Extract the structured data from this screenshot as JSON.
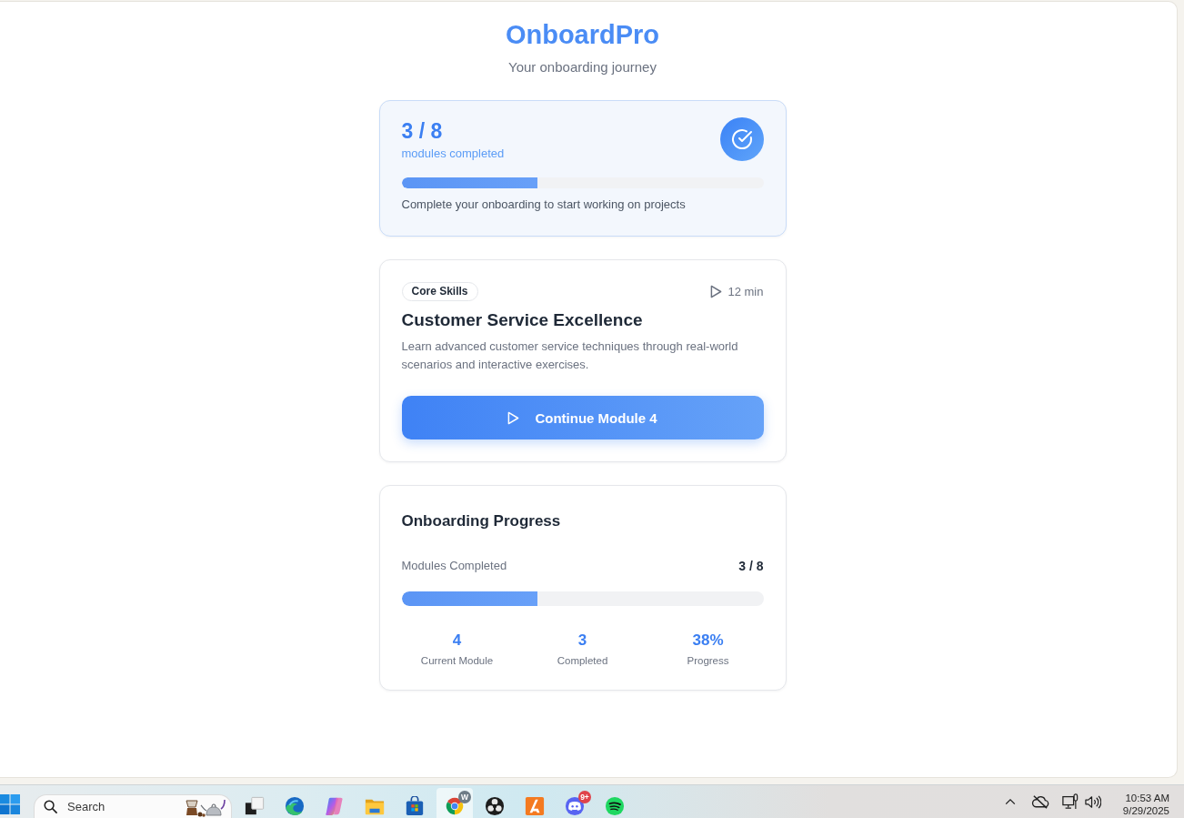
{
  "header": {
    "title": "OnboardPro",
    "subtitle": "Your onboarding journey"
  },
  "summary_card": {
    "count": "3 / 8",
    "caption": "modules completed",
    "level": 0.375,
    "note": "Complete your onboarding to start working on projects"
  },
  "module_card": {
    "tag": "Core Skills",
    "duration": "12 min",
    "title": "Customer Service Excellence",
    "description": "Learn advanced customer service techniques through real-world scenarios and interactive exercises.",
    "button": "Continue Module 4"
  },
  "progress_card": {
    "title": "Onboarding Progress",
    "label": "Modules Completed",
    "value": "3 / 8",
    "level": 0.375,
    "stats": [
      {
        "value": "4",
        "label": "Current Module"
      },
      {
        "value": "3",
        "label": "Completed"
      },
      {
        "value": "38%",
        "label": "Progress"
      }
    ]
  },
  "taskbar": {
    "search": {
      "placeholder": "Search"
    },
    "apps": [
      {
        "kind": "taskview",
        "selected": false
      },
      {
        "kind": "wave",
        "selected": false
      },
      {
        "kind": "petals",
        "selected": false
      },
      {
        "kind": "folder",
        "selected": false
      },
      {
        "kind": "bag",
        "selected": false
      },
      {
        "kind": "ring",
        "selected": true,
        "badge": "W"
      },
      {
        "kind": "aperture",
        "selected": false
      },
      {
        "kind": "tile",
        "selected": false
      },
      {
        "kind": "gamepad",
        "selected": false,
        "badge": "9+"
      },
      {
        "kind": "arcs",
        "selected": false
      }
    ],
    "clock": {
      "time": "10:53 AM",
      "date": "9/29/2025"
    }
  }
}
